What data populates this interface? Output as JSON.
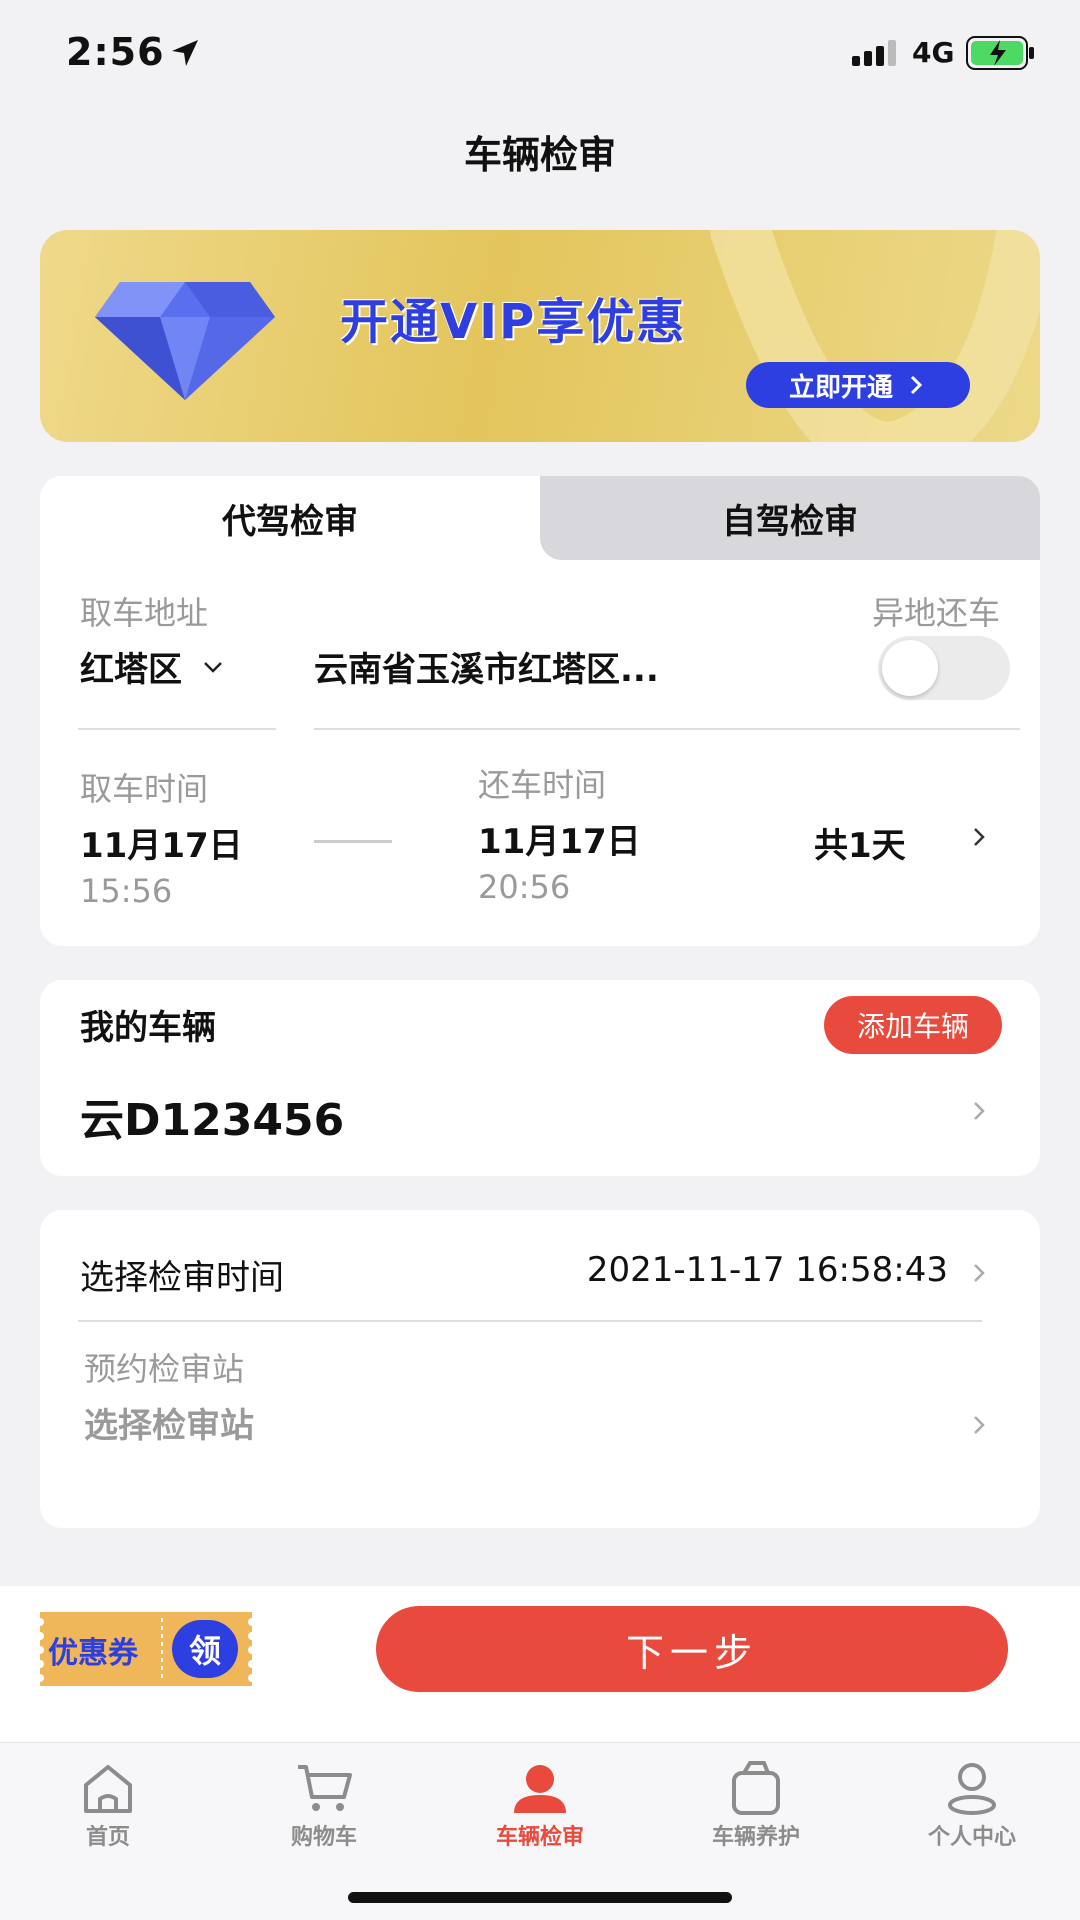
{
  "status_bar": {
    "time": "2:56",
    "network": "4G"
  },
  "page_title": "车辆检审",
  "banner": {
    "title": "开通VIP享优惠",
    "button_label": "立即开通"
  },
  "service_tabs": [
    {
      "label": "代驾检审",
      "active": true
    },
    {
      "label": "自驾检审",
      "active": false
    }
  ],
  "pickup": {
    "address_label": "取车地址",
    "district": "红塔区",
    "address": "云南省玉溪市红塔区...",
    "return_elsewhere_label": "异地还车",
    "return_elsewhere_on": false
  },
  "schedule": {
    "pickup_label": "取车时间",
    "pickup_date": "11月17日",
    "pickup_time": "15:56",
    "return_label": "还车时间",
    "return_date": "11月17日",
    "return_time": "20:56",
    "duration": "共1天"
  },
  "vehicle": {
    "section_title": "我的车辆",
    "add_button": "添加车辆",
    "plate": "云D123456"
  },
  "inspection": {
    "time_label": "选择检审时间",
    "time_value": "2021-11-17 16:58:43",
    "station_label": "预约检审站",
    "station_placeholder": "选择检审站"
  },
  "coupon": {
    "label": "优惠券",
    "claim": "领"
  },
  "next_button": "下一步",
  "tabbar": [
    {
      "label": "首页",
      "icon": "home-icon",
      "active": false
    },
    {
      "label": "购物车",
      "icon": "cart-icon",
      "active": false
    },
    {
      "label": "车辆检审",
      "icon": "person-icon",
      "active": true
    },
    {
      "label": "车辆养护",
      "icon": "bag-icon",
      "active": false
    },
    {
      "label": "个人中心",
      "icon": "user-icon",
      "active": false
    }
  ],
  "colors": {
    "accent": "#e84a3d",
    "vip_blue": "#2d3fe0",
    "banner_gold": "#e3c55c"
  }
}
